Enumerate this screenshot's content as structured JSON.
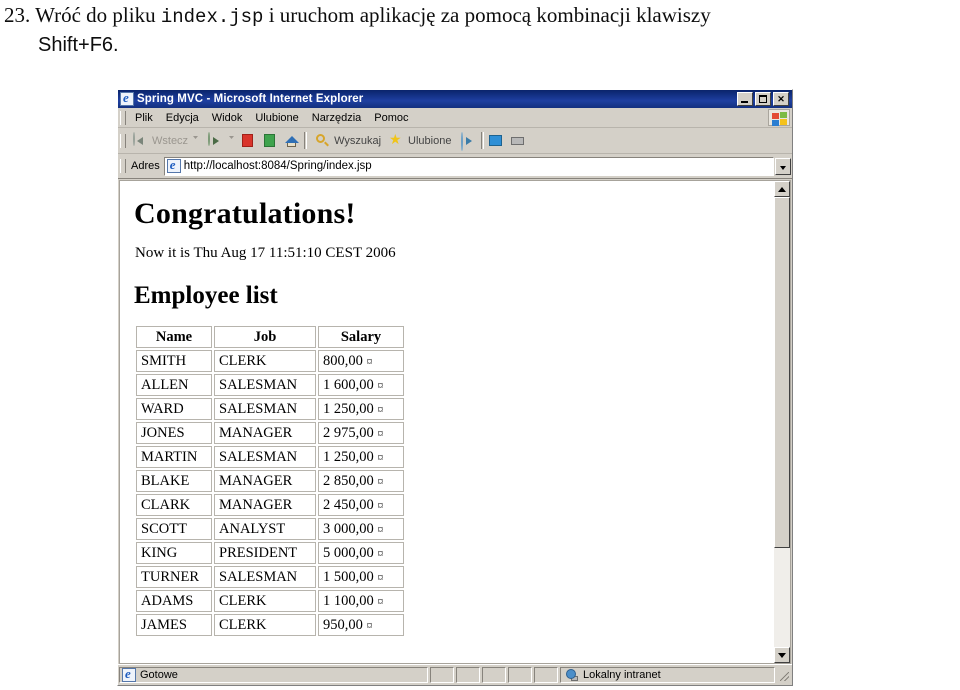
{
  "instruction": {
    "number": "23.",
    "part1": "Wróć do pliku ",
    "code": "index.jsp",
    "part2": " i uruchom aplikację za pomocą kombinacji klawiszy",
    "line2": "Shift+F6."
  },
  "browser": {
    "title": "Spring MVC - Microsoft Internet Explorer",
    "title_icon": "ie-icon",
    "window_buttons": {
      "minimize": "minimize-button",
      "maximize": "maximize-button",
      "close": "✕"
    },
    "menu": [
      {
        "label": "Plik",
        "accel": "P"
      },
      {
        "label": "Edycja",
        "accel": "E"
      },
      {
        "label": "Widok",
        "accel": "W"
      },
      {
        "label": "Ulubione",
        "accel": "U"
      },
      {
        "label": "Narzędzia",
        "accel": "N"
      },
      {
        "label": "Pomoc",
        "accel": "c"
      }
    ],
    "toolbar": {
      "back": "Wstecz",
      "search": "Wyszukaj",
      "favorites": "Ulubione",
      "icons": {
        "back": "back-arrow-icon",
        "forward": "forward-arrow-icon",
        "stop": "stop-icon",
        "refresh": "refresh-icon",
        "home": "home-icon",
        "search": "search-magnifier-icon",
        "favorites": "favorites-star-icon",
        "media": "media-icon",
        "mail": "mail-icon",
        "print": "print-icon"
      }
    },
    "address": {
      "label": "Adres",
      "url": "http://localhost:8084/Spring/index.jsp",
      "icon": "ie-page-icon"
    },
    "statusbar": {
      "status": "Gotowe",
      "zone": "Lokalny intranet",
      "status_icon": "ie-icon",
      "zone_icon": "local-intranet-icon"
    },
    "scrollbar": {
      "up": "scroll-up-arrow",
      "down": "scroll-down-arrow",
      "thumb_position_percent": 0
    }
  },
  "page": {
    "heading": "Congratulations!",
    "now_line": "Now it is Thu Aug 17 11:51:10 CEST 2006",
    "subheading": "Employee list",
    "table": {
      "headers": [
        "Name",
        "Job",
        "Salary"
      ],
      "currency_symbol": "¤",
      "rows": [
        {
          "name": "SMITH",
          "job": "CLERK",
          "salary": "800,00"
        },
        {
          "name": "ALLEN",
          "job": "SALESMAN",
          "salary": "1 600,00"
        },
        {
          "name": "WARD",
          "job": "SALESMAN",
          "salary": "1 250,00"
        },
        {
          "name": "JONES",
          "job": "MANAGER",
          "salary": "2 975,00"
        },
        {
          "name": "MARTIN",
          "job": "SALESMAN",
          "salary": "1 250,00"
        },
        {
          "name": "BLAKE",
          "job": "MANAGER",
          "salary": "2 850,00"
        },
        {
          "name": "CLARK",
          "job": "MANAGER",
          "salary": "2 450,00"
        },
        {
          "name": "SCOTT",
          "job": "ANALYST",
          "salary": "3 000,00"
        },
        {
          "name": "KING",
          "job": "PRESIDENT",
          "salary": "5 000,00"
        },
        {
          "name": "TURNER",
          "job": "SALESMAN",
          "salary": "1 500,00"
        },
        {
          "name": "ADAMS",
          "job": "CLERK",
          "salary": "1 100,00"
        },
        {
          "name": "JAMES",
          "job": "CLERK",
          "salary": "950,00"
        }
      ]
    }
  },
  "colors": {
    "titlebar": "#0a246a",
    "chrome": "#d4d0c8",
    "page_bg": "#ffffff"
  }
}
